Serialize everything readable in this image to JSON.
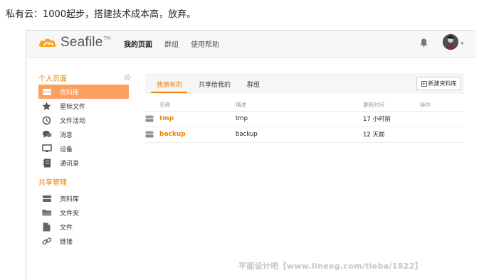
{
  "caption": "私有云：1000起步，搭建技术成本高，放弃。",
  "app": {
    "name": "Seafile",
    "tm": "TM"
  },
  "topnav": [
    {
      "label": "我的页面",
      "active": true
    },
    {
      "label": "群组",
      "active": false
    },
    {
      "label": "使用帮助",
      "active": false
    }
  ],
  "sidebar": {
    "personal_heading": "个人页面",
    "personal_items": [
      {
        "label": "资料库",
        "icon": "library-icon",
        "active": true
      },
      {
        "label": "星标文件",
        "icon": "star-icon",
        "active": false
      },
      {
        "label": "文件活动",
        "icon": "history-icon",
        "active": false
      },
      {
        "label": "消息",
        "icon": "message-icon",
        "active": false
      },
      {
        "label": "设备",
        "icon": "monitor-icon",
        "active": false
      },
      {
        "label": "通讯录",
        "icon": "contacts-icon",
        "active": false
      }
    ],
    "shared_heading": "共享管理",
    "shared_items": [
      {
        "label": "资料库",
        "icon": "library-icon"
      },
      {
        "label": "文件夹",
        "icon": "folder-icon"
      },
      {
        "label": "文件",
        "icon": "file-icon"
      },
      {
        "label": "链接",
        "icon": "link-icon"
      }
    ]
  },
  "tabs": [
    {
      "label": "我拥有的",
      "active": true
    },
    {
      "label": "共享给我的",
      "active": false
    },
    {
      "label": "群组",
      "active": false
    }
  ],
  "new_library_button": "新建资料库",
  "table": {
    "headers": [
      "名称",
      "描述",
      "更新时间",
      "操作"
    ],
    "rows": [
      {
        "name": "tmp",
        "description": "tmp",
        "updated": "17 小时前"
      },
      {
        "name": "backup",
        "description": "backup",
        "updated": "12 天前"
      }
    ]
  },
  "watermark": "平面设计吧【www.lineeg.com/tieba/1822】",
  "colors": {
    "accent": "#eb8205",
    "active_item_bg": "#faa162"
  }
}
